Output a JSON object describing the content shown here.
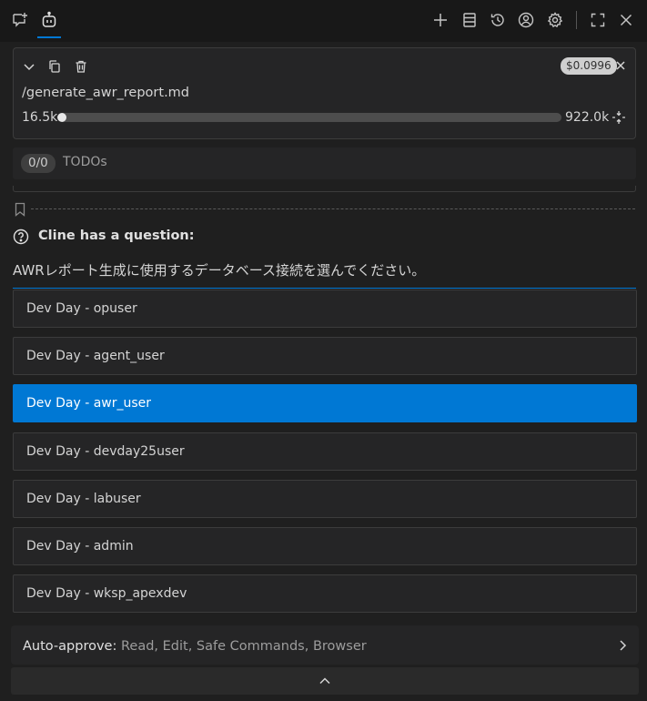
{
  "header": {
    "icons": [
      "chat-plus-icon",
      "robot-icon",
      "plus-icon",
      "history-list-icon",
      "history-icon",
      "account-icon",
      "gear-icon",
      "fullscreen-icon",
      "close-icon"
    ]
  },
  "task": {
    "cost": "$0.0996",
    "title": "/generate_awr_report.md",
    "tokens_used": "16.5k",
    "tokens_max": "922.0k",
    "context_progress": 0.018
  },
  "todos": {
    "count": "0/0",
    "label": "TODOs"
  },
  "question": {
    "title": "Cline has a question:",
    "text": "AWRレポート生成に使用するデータベース接続を選んでください。",
    "options": [
      "Dev Day - opuser",
      "Dev Day - agent_user",
      "Dev Day - awr_user",
      "Dev Day - devday25user",
      "Dev Day - labuser",
      "Dev Day - admin",
      "Dev Day - wksp_apexdev"
    ],
    "selected_option": "Dev Day - awr_user"
  },
  "auto_approve": {
    "label": "Auto-approve:",
    "items": "Read, Edit, Safe Commands, Browser"
  },
  "colors": {
    "accent": "#0078d4",
    "background": "#1f1f1f",
    "panel": "#252526"
  }
}
